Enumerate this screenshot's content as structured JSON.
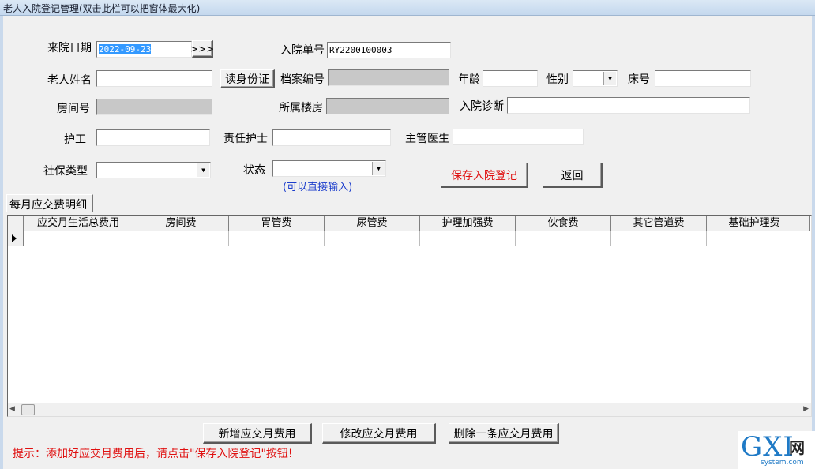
{
  "window": {
    "title": "老人入院登记管理(双击此栏可以把窗体最大化)"
  },
  "form": {
    "admit_date_label": "来院日期",
    "admit_date_value": "2022-09-23",
    "date_picker_label": ">>>",
    "admit_no_label": "入院单号",
    "admit_no_value": "RY2200100003",
    "elder_name_label": "老人姓名",
    "elder_name_value": "",
    "read_id_button": "读身份证",
    "file_no_label": "档案编号",
    "file_no_value": "",
    "age_label": "年龄",
    "age_value": "",
    "gender_label": "性别",
    "gender_value": "",
    "bed_no_label": "床号",
    "bed_no_value": "",
    "room_no_label": "房间号",
    "room_no_value": "",
    "building_label": "所属楼房",
    "building_value": "",
    "diagnosis_label": "入院诊断",
    "diagnosis_value": "",
    "caregiver_label": "护工",
    "caregiver_value": "",
    "nurse_label": "责任护士",
    "nurse_value": "",
    "doctor_label": "主管医生",
    "doctor_value": "",
    "insurance_label": "社保类型",
    "insurance_value": "",
    "status_label": "状态",
    "status_value": "",
    "status_hint": "(可以直接输入)",
    "save_button": "保存入院登记",
    "back_button": "返回"
  },
  "fees": {
    "tab_label": "每月应交费明细",
    "columns": [
      "应交月生活总费用",
      "房间费",
      "胃管费",
      "尿管费",
      "护理加强费",
      "伙食费",
      "其它管道费",
      "基础护理费"
    ],
    "add_button": "新增应交月费用",
    "edit_button": "修改应交月费用",
    "delete_button": "删除一条应交月费用"
  },
  "tip": "提示：添加好应交月费用后，请点击\"保存入院登记\"按钮!",
  "watermark": {
    "logo": "GXI",
    "cn": "网",
    "sub": "system.com"
  },
  "colors": {
    "accent_red": "#e01010",
    "hint_blue": "#1a3ccc",
    "selection": "#3399ff"
  }
}
